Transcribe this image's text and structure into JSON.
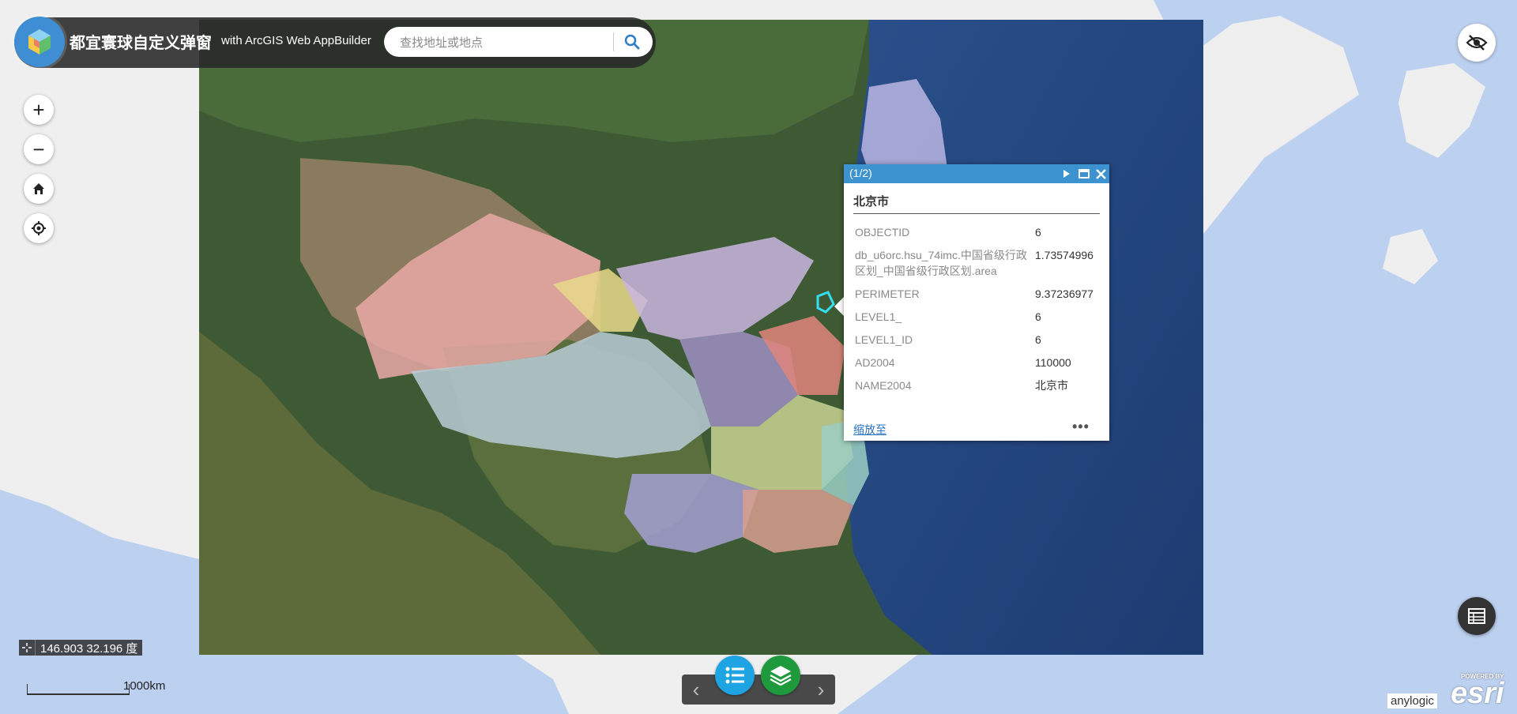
{
  "header": {
    "title": "都宜寰球自定义弹窗",
    "subtitle": "with ArcGIS Web AppBuilder",
    "search": {
      "placeholder": "查找地址或地点",
      "value": ""
    }
  },
  "map_controls": {
    "zoom_in": "+",
    "zoom_out": "−",
    "home_icon": "home-icon",
    "locate_icon": "locate-icon"
  },
  "popup": {
    "count": "(1/2)",
    "title": "北京市",
    "attributes": [
      {
        "key": "OBJECTID",
        "value": "6"
      },
      {
        "key": "db_u6orc.hsu_74imc.中国省级行政区划_中国省级行政区划.area",
        "value": "1.73574996"
      },
      {
        "key": "PERIMETER",
        "value": "9.37236977"
      },
      {
        "key": "LEVEL1_",
        "value": "6"
      },
      {
        "key": "LEVEL1_ID",
        "value": "6"
      },
      {
        "key": "AD2004",
        "value": "110000"
      },
      {
        "key": "NAME2004",
        "value": "北京市"
      }
    ],
    "zoom_link": "缩放至",
    "more": "•••"
  },
  "coordinates": {
    "text": "146.903 32.196 度"
  },
  "scalebar": {
    "label": "1000km"
  },
  "bottom_dock": {
    "prev": "‹",
    "next": "›",
    "legend_icon": "list-icon",
    "layers_icon": "layers-icon"
  },
  "attribution": "anylogic",
  "esri_logo": {
    "powered": "POWERED BY",
    "name": "esri"
  },
  "colors": {
    "header_bg": "#2a2a2a",
    "popup_header": "#3d93cf",
    "legend_btn": "#1ea3e3",
    "layers_btn": "#1e9a3c",
    "basemap_water": "#bcd0f0",
    "basemap_land": "#efefef"
  }
}
